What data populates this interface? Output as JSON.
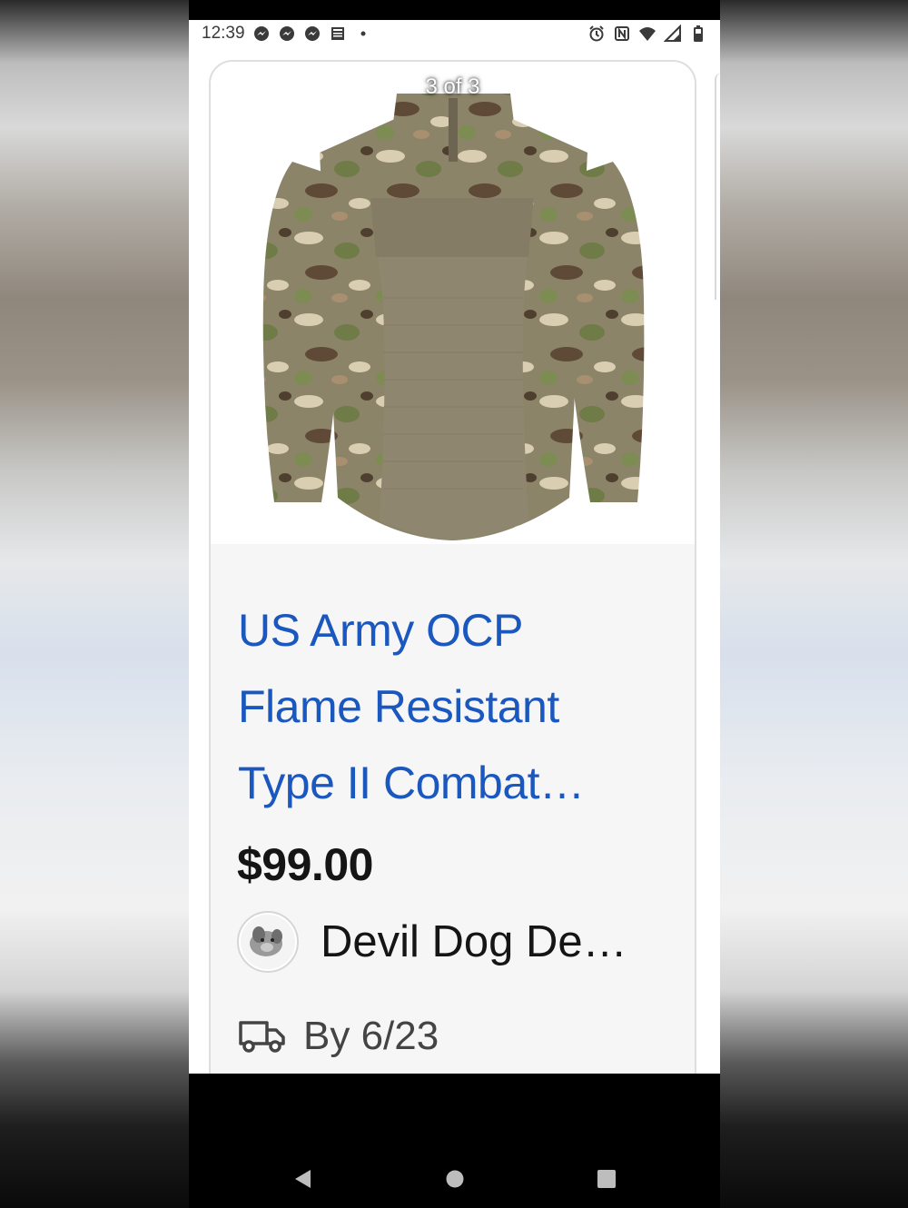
{
  "status_bar": {
    "time": "12:39",
    "left_icons": [
      "messenger-icon",
      "messenger-icon",
      "messenger-icon",
      "news-icon",
      "dot-icon"
    ],
    "right_icons": [
      "alarm-icon",
      "nfc-icon",
      "wifi-icon",
      "signal-icon",
      "battery-icon"
    ]
  },
  "listing": {
    "image_counter": "3 of 3",
    "image_icon": "camo-shirt-image",
    "title_lines": [
      "US Army OCP",
      "Flame Resistant",
      "Type II Combat…"
    ],
    "price": "$99.00",
    "seller": "Devil Dog De…",
    "delivery": "By 6/23"
  },
  "nav_bar": {
    "icons": [
      "back-icon",
      "home-icon",
      "recents-icon"
    ]
  },
  "colors": {
    "title": "#1a58c0",
    "price": "#151515",
    "card_bg": "#f6f6f6"
  }
}
